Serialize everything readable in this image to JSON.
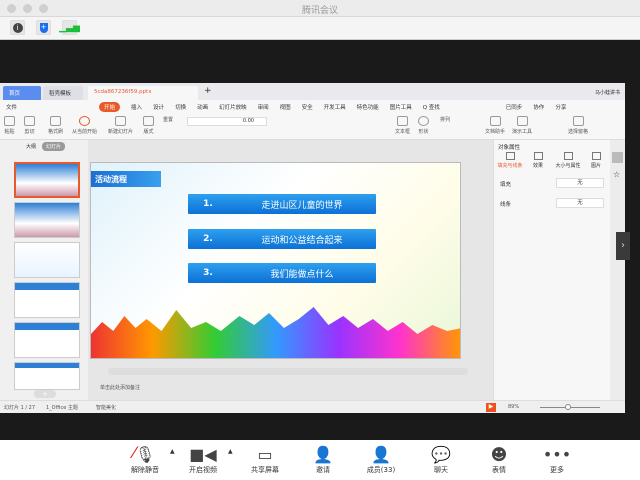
{
  "window": {
    "title": "腾讯会议"
  },
  "toolbar": {
    "icons": [
      "info-icon",
      "shield-icon",
      "signal-icon"
    ]
  },
  "wps": {
    "tabs": [
      {
        "label": "首页"
      },
      {
        "label": "稻壳模板"
      },
      {
        "label": "5cda867236f59.pptx"
      }
    ],
    "tab_new": "+",
    "user": "马小蛙讲书",
    "menu": [
      "文件",
      "开始",
      "插入",
      "设计",
      "切换",
      "动画",
      "幻灯片放映",
      "审阅",
      "视图",
      "安全",
      "开发工具",
      "特色功能",
      "图片工具",
      "Q 查找"
    ],
    "menu_right": [
      "已同步",
      "协作",
      "分享"
    ],
    "ribbon": [
      "粘贴",
      "剪切",
      "格式刷",
      "从当前开始",
      "新建幻灯片",
      "版式",
      "重置",
      "文本框",
      "形状",
      "排列",
      "文档助手",
      "演示工具",
      "选择窗格"
    ],
    "font_size": "0.00",
    "thumb_tabs": [
      "大纲",
      "幻灯片"
    ],
    "slide": {
      "title": "活动流程",
      "items": [
        {
          "num": "1.",
          "text": "走进山区儿童的世界"
        },
        {
          "num": "2.",
          "text": "运动和公益结合起来"
        },
        {
          "num": "3.",
          "text": "我们能做点什么"
        }
      ]
    },
    "notes_hint": "单击此处添加备注",
    "panel": {
      "title": "对象属性",
      "tabs": [
        "填充与线条",
        "效果",
        "大小与属性",
        "图片"
      ],
      "rows": [
        {
          "label": "填充",
          "value": "无"
        },
        {
          "label": "线条",
          "value": "无"
        }
      ]
    },
    "status": {
      "slide": "幻灯片 1 / 27",
      "theme": "1_Office 主题",
      "beautify": "智能美化",
      "zoom": "89%"
    }
  },
  "bottom_bar": [
    {
      "label": "解除静音",
      "icon": "mic-muted-icon"
    },
    {
      "label": "开启视频",
      "icon": "video-off-icon"
    },
    {
      "label": "共享屏幕",
      "icon": "share-screen-icon"
    },
    {
      "label": "邀请",
      "icon": "invite-icon"
    },
    {
      "label": "成员(33)",
      "icon": "members-icon"
    },
    {
      "label": "聊天",
      "icon": "chat-icon"
    },
    {
      "label": "表情",
      "icon": "emoji-icon"
    },
    {
      "label": "更多",
      "icon": "more-icon"
    }
  ],
  "colors": {
    "accent": "#e85a2a",
    "slide_blue": "#1c7ee0",
    "mute_red": "#e02020"
  }
}
